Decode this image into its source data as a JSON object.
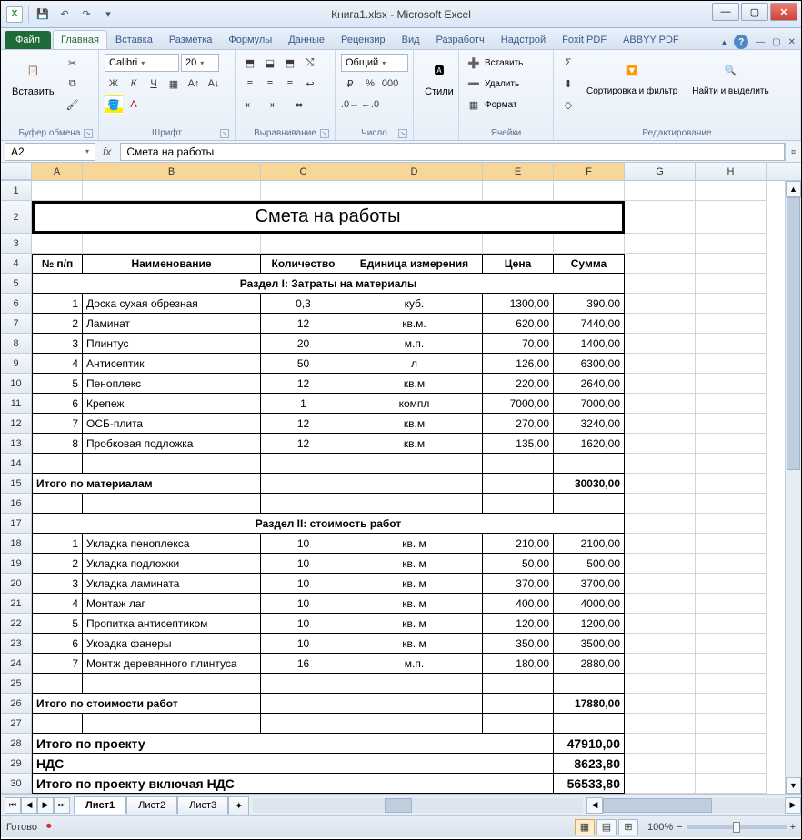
{
  "window": {
    "title": "Книга1.xlsx  -  Microsoft Excel"
  },
  "qat": {
    "save": "💾",
    "undo": "↶",
    "redo": "↷"
  },
  "tabs": {
    "file": "Файл",
    "items": [
      "Главная",
      "Вставка",
      "Разметка",
      "Формулы",
      "Данные",
      "Рецензир",
      "Вид",
      "Разработч",
      "Надстрой",
      "Foxit PDF",
      "ABBYY PDF"
    ],
    "active": 0
  },
  "ribbon": {
    "clipboard": {
      "paste": "Вставить",
      "label": "Буфер обмена"
    },
    "font": {
      "name": "Calibri",
      "size": "20",
      "label": "Шрифт",
      "bold": "Ж",
      "italic": "К",
      "underline": "Ч"
    },
    "align": {
      "label": "Выравнивание"
    },
    "number": {
      "format": "Общий",
      "label": "Число"
    },
    "styles": {
      "btn": "Стили"
    },
    "cells": {
      "insert": "Вставить",
      "delete": "Удалить",
      "format": "Формат",
      "label": "Ячейки"
    },
    "editing": {
      "sort": "Сортировка и фильтр",
      "find": "Найти и выделить",
      "label": "Редактирование"
    }
  },
  "formula": {
    "cellref": "A2",
    "fx": "fx",
    "value": "Смета на работы"
  },
  "cols": [
    "A",
    "B",
    "C",
    "D",
    "E",
    "F",
    "G",
    "H"
  ],
  "sheet": {
    "title": "Смета на работы",
    "headers": {
      "n": "№ п/п",
      "name": "Наименование",
      "qty": "Количество",
      "unit": "Единица измерения",
      "price": "Цена",
      "sum": "Сумма"
    },
    "section1": "Раздел I: Затраты на материалы",
    "rows1": [
      {
        "n": "1",
        "name": "Доска сухая обрезная",
        "qty": "0,3",
        "unit": "куб.",
        "price": "1300,00",
        "sum": "390,00"
      },
      {
        "n": "2",
        "name": "Ламинат",
        "qty": "12",
        "unit": "кв.м.",
        "price": "620,00",
        "sum": "7440,00"
      },
      {
        "n": "3",
        "name": "Плинтус",
        "qty": "20",
        "unit": "м.п.",
        "price": "70,00",
        "sum": "1400,00"
      },
      {
        "n": "4",
        "name": "Антисептик",
        "qty": "50",
        "unit": "л",
        "price": "126,00",
        "sum": "6300,00"
      },
      {
        "n": "5",
        "name": "Пеноплекс",
        "qty": "12",
        "unit": "кв.м",
        "price": "220,00",
        "sum": "2640,00"
      },
      {
        "n": "6",
        "name": "Крепеж",
        "qty": "1",
        "unit": "компл",
        "price": "7000,00",
        "sum": "7000,00"
      },
      {
        "n": "7",
        "name": "ОСБ-плита",
        "qty": "12",
        "unit": "кв.м",
        "price": "270,00",
        "sum": "3240,00"
      },
      {
        "n": "8",
        "name": "Пробковая подложка",
        "qty": "12",
        "unit": "кв.м",
        "price": "135,00",
        "sum": "1620,00"
      }
    ],
    "total1": {
      "label": "Итого по материалам",
      "sum": "30030,00"
    },
    "section2": "Раздел II: стоимость работ",
    "rows2": [
      {
        "n": "1",
        "name": "Укладка пеноплекса",
        "qty": "10",
        "unit": "кв. м",
        "price": "210,00",
        "sum": "2100,00"
      },
      {
        "n": "2",
        "name": "Укладка подложки",
        "qty": "10",
        "unit": "кв. м",
        "price": "50,00",
        "sum": "500,00"
      },
      {
        "n": "3",
        "name": "Укладка  ламината",
        "qty": "10",
        "unit": "кв. м",
        "price": "370,00",
        "sum": "3700,00"
      },
      {
        "n": "4",
        "name": "Монтаж лаг",
        "qty": "10",
        "unit": "кв. м",
        "price": "400,00",
        "sum": "4000,00"
      },
      {
        "n": "5",
        "name": "Пропитка антисептиком",
        "qty": "10",
        "unit": "кв. м",
        "price": "120,00",
        "sum": "1200,00"
      },
      {
        "n": "6",
        "name": "Укоадка фанеры",
        "qty": "10",
        "unit": "кв. м",
        "price": "350,00",
        "sum": "3500,00"
      },
      {
        "n": "7",
        "name": "Монтж деревянного плинтуса",
        "qty": "16",
        "unit": "м.п.",
        "price": "180,00",
        "sum": "2880,00"
      }
    ],
    "total2": {
      "label": "Итого по стоимости работ",
      "sum": "17880,00"
    },
    "grand": {
      "label": "Итого по проекту",
      "sum": "47910,00"
    },
    "vat": {
      "label": "НДС",
      "sum": "8623,80"
    },
    "grandvat": {
      "label": "Итого по проекту включая НДС",
      "sum": "56533,80"
    }
  },
  "sheets": [
    "Лист1",
    "Лист2",
    "Лист3"
  ],
  "status": {
    "ready": "Готово",
    "zoom": "100%"
  }
}
